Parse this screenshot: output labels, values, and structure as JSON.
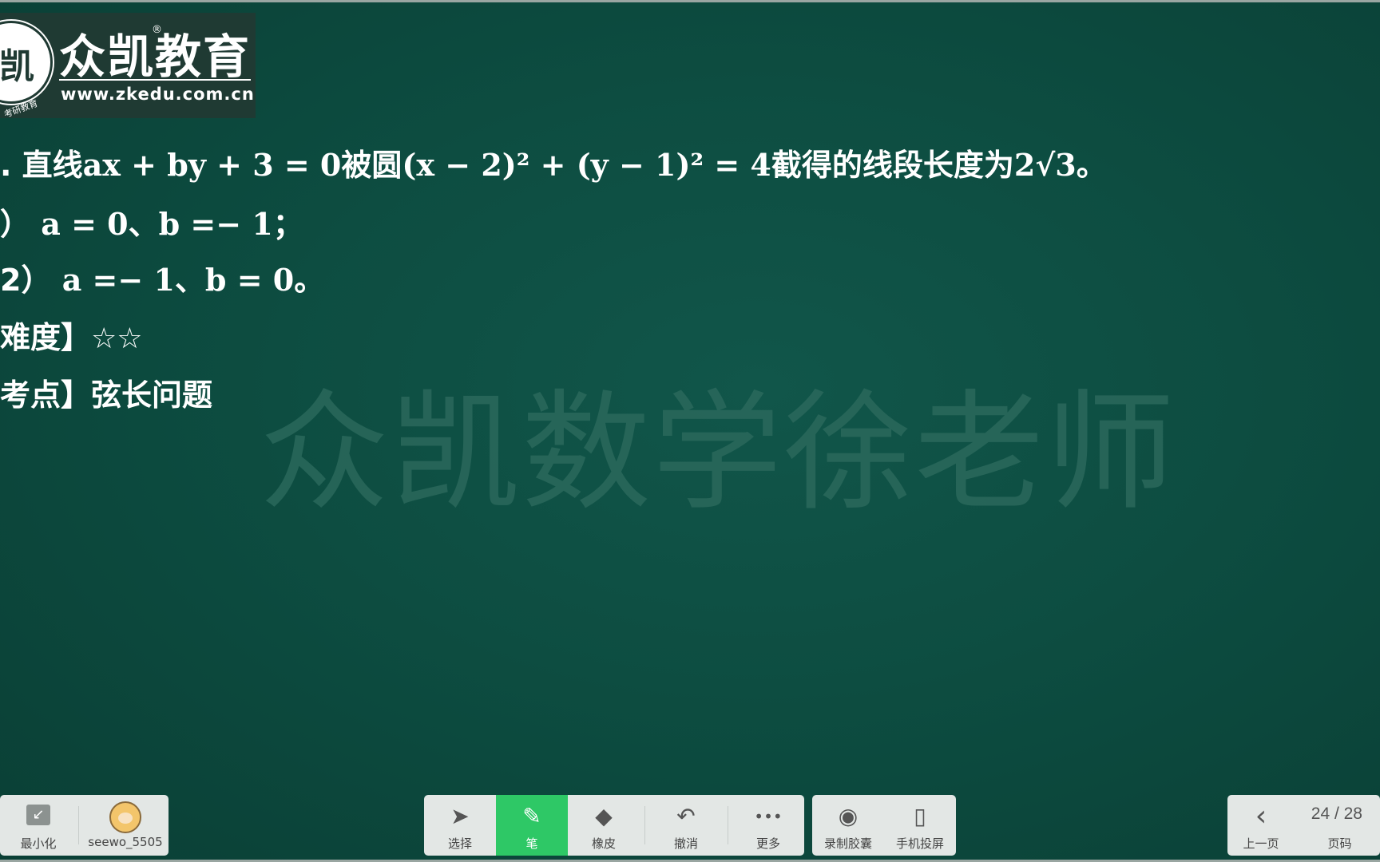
{
  "logo": {
    "seal_char": "凯",
    "brand": "众凯教育",
    "reg_mark": "®",
    "url": "www.zkedu.com.cn",
    "seal_ring_text": "考研教育"
  },
  "content": {
    "line1_prefix": ". 直线",
    "line1_eq1": "ax + by + 3 = 0",
    "line1_mid": "被圆",
    "line1_eq2": "(x − 2)² + (y − 1)² = 4",
    "line1_suffix": "截得的线段长度为",
    "line1_value": "2√3",
    "line1_end": "。",
    "line2_prefix": "）",
    "line2_math": "a = 0、b =− 1；",
    "line3_prefix": "2）",
    "line3_math": "a =− 1、b = 0。",
    "line4_label": "难度】",
    "line4_stars": "☆☆",
    "line5_label": "考点】弦长问题"
  },
  "watermark": "众凯数学徐老师",
  "toolbar": {
    "left": [
      {
        "label": "最小化",
        "icon": "minimize-icon",
        "glyph": "↙"
      },
      {
        "label": "seewo_5505",
        "icon": "avatar-icon"
      }
    ],
    "tools": [
      {
        "label": "选择",
        "icon": "cursor-icon",
        "glyph": "➤"
      },
      {
        "label": "笔",
        "icon": "pen-icon",
        "glyph": "✎"
      },
      {
        "label": "橡皮",
        "icon": "eraser-icon",
        "glyph": "◆"
      },
      {
        "label": "撤消",
        "icon": "undo-icon",
        "glyph": "↶"
      },
      {
        "label": "更多",
        "icon": "more-icon",
        "glyph": "•••"
      }
    ],
    "extra": [
      {
        "label": "录制胶囊",
        "icon": "record-icon",
        "glyph": "◉"
      },
      {
        "label": "手机投屏",
        "icon": "phone-icon",
        "glyph": "▯"
      }
    ],
    "nav": {
      "prev_label": "上一页",
      "prev_glyph": "‹",
      "page_label": "页码",
      "page_text": "24 / 28"
    }
  },
  "colors": {
    "board_green": "#0d4d41",
    "active_green": "#2ec866",
    "toolbar_bg": "#e3e7e5"
  }
}
